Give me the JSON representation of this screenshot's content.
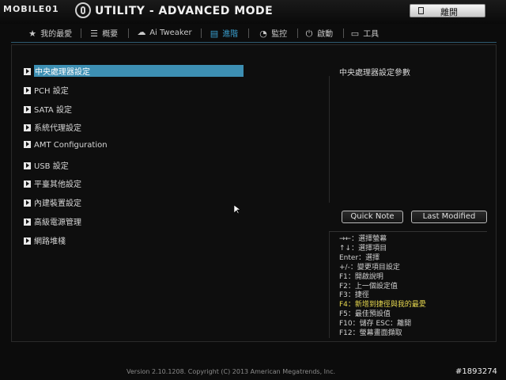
{
  "header": {
    "brand": "MOBILE01",
    "title": "UTILITY - ADVANCED MODE",
    "exit_label": "離開"
  },
  "tabs": [
    {
      "label": "我的最愛",
      "icon": "star-icon"
    },
    {
      "label": "概要",
      "icon": "list-icon"
    },
    {
      "label": "Ai Tweaker",
      "icon": "ai-tweaker-icon"
    },
    {
      "label": "進階",
      "icon": "advanced-icon"
    },
    {
      "label": "監控",
      "icon": "monitor-icon"
    },
    {
      "label": "啟動",
      "icon": "power-icon"
    },
    {
      "label": "工具",
      "icon": "tool-icon"
    }
  ],
  "active_tab": "進階",
  "menu": [
    "中央處理器設定",
    "PCH 設定",
    "SATA 設定",
    "系統代理設定",
    "AMT Configuration",
    "USB 設定",
    "平臺其他設定",
    "內建裝置設定",
    "高級電源管理",
    "網路堆棧"
  ],
  "help": {
    "title": "中央處理器設定參數",
    "quick_note": "Quick Note",
    "last_modified": "Last Modified",
    "keys": [
      "→←：選擇螢幕",
      "↑↓：選擇項目",
      "Enter：選擇",
      "+/-：變更項目設定",
      "F1：開啟說明",
      "F2：上一個設定值",
      "F3：捷徑",
      "F4：新增到捷徑與我的最愛",
      "F5：最佳預設值",
      "F10：儲存  ESC：離開",
      "F12：螢幕畫面擷取"
    ]
  },
  "footer": "Version 2.10.1208. Copyright (C) 2013 American Megatrends, Inc.",
  "post_id": "#1893274",
  "colors": {
    "accent": "#3d8fb3",
    "highlight": "#e7d84f"
  }
}
